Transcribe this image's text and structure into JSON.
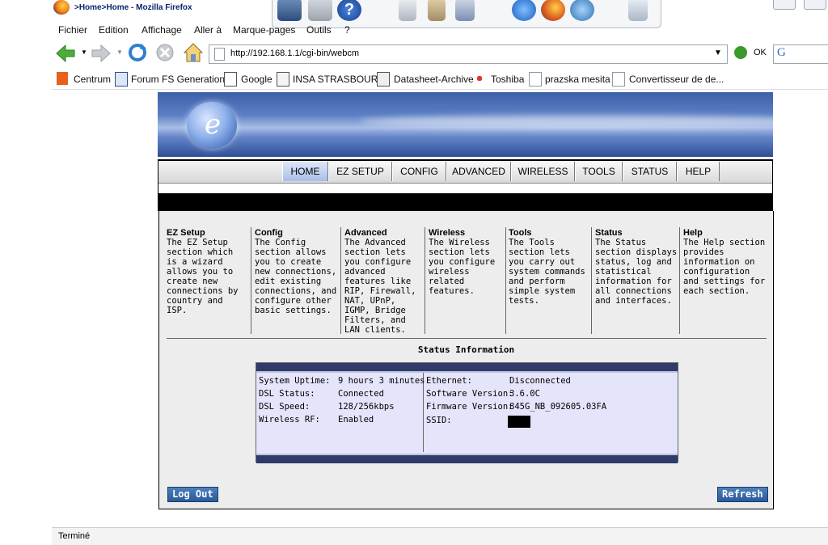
{
  "window": {
    "title": ">Home>Home - Mozilla Firefox"
  },
  "menu": {
    "items": [
      {
        "label": "Fichier",
        "key": "F"
      },
      {
        "label": "Edition",
        "key": "E"
      },
      {
        "label": "Affichage",
        "key": "A"
      },
      {
        "label": "Aller à",
        "key": "A"
      },
      {
        "label": "Marque-pages",
        "key": "M"
      },
      {
        "label": "Outils",
        "key": "O"
      },
      {
        "label": "?",
        "key": "?"
      }
    ]
  },
  "navbar": {
    "url": "http://192.168.1.1/cgi-bin/webcm",
    "go_label": "OK"
  },
  "bookmarks": [
    "Centrum",
    "Forum FS Generation",
    "Google",
    "INSA STRASBOURG",
    "Datasheet-Archive",
    "Toshiba",
    "prazska mesita",
    "Convertisseur de de..."
  ],
  "router": {
    "tabs": [
      "HOME",
      "EZ SETUP",
      "CONFIG",
      "ADVANCED",
      "WIRELESS",
      "TOOLS",
      "STATUS",
      "HELP"
    ],
    "active_tab": "HOME",
    "sections": [
      {
        "title": "EZ Setup",
        "text": "The EZ Setup section which is a wizard allows you to create new connections by country and ISP."
      },
      {
        "title": "Config",
        "text": "The Config section allows you to create new connections, edit existing connections, and configure other basic settings."
      },
      {
        "title": "Advanced",
        "text": "The Advanced section lets you configure advanced features like RIP, Firewall, NAT, UPnP, IGMP, Bridge Filters, and LAN clients."
      },
      {
        "title": "Wireless",
        "text": "The Wireless section lets you configure wireless related features."
      },
      {
        "title": "Tools",
        "text": "The Tools section lets you carry out system commands and perform simple system tests."
      },
      {
        "title": "Status",
        "text": "The Status section displays status, log and statistical information for all connections and interfaces."
      },
      {
        "title": "Help",
        "text": "The Help section provides information on configuration and settings for each section."
      }
    ],
    "status_title": "Status Information",
    "status_left": [
      {
        "label": "System Uptime:",
        "value": "9 hours 3 minutes"
      },
      {
        "label": "DSL Status:",
        "value": "Connected"
      },
      {
        "label": "DSL Speed:",
        "value": "128/256kbps"
      },
      {
        "label": "Wireless RF:",
        "value": "Enabled"
      }
    ],
    "status_right": [
      {
        "label": "Ethernet:",
        "value": "Disconnected"
      },
      {
        "label": "Software Version:",
        "value": "3.6.0C"
      },
      {
        "label": "Firmware Version:",
        "value": "845G_NB_092605.03FA"
      },
      {
        "label": "SSID:",
        "value": ""
      }
    ],
    "logout_label": "Log Out",
    "refresh_label": "Refresh"
  },
  "statusbar": {
    "text": "Terminé"
  },
  "colors": {
    "accent": "#2a5a98",
    "status_header": "#2f3b6a",
    "status_bg": "#e4e4fb"
  }
}
